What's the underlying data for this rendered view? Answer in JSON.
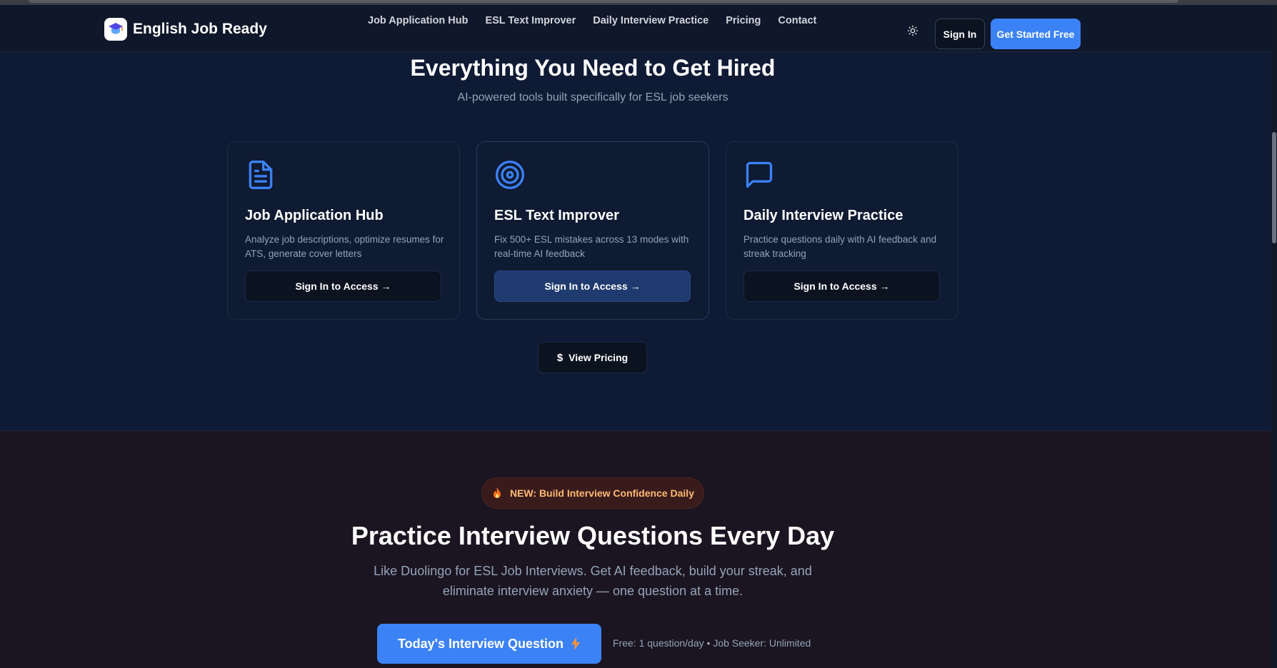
{
  "brand": {
    "name": "English Job Ready"
  },
  "nav": {
    "items": [
      {
        "label": "Job Application Hub"
      },
      {
        "label": "ESL Text Improver"
      },
      {
        "label": "Daily Interview Practice"
      },
      {
        "label": "Pricing"
      },
      {
        "label": "Contact"
      }
    ]
  },
  "header": {
    "theme_toggle_icon": "sun-icon",
    "sign_in_label": "Sign In",
    "get_started_label": "Get Started Free"
  },
  "features": {
    "title": "Everything You Need to Get Hired",
    "subtitle": "AI-powered tools built specifically for ESL job seekers",
    "cards": [
      {
        "icon": "document-icon",
        "title": "Job Application Hub",
        "description": "Analyze job descriptions, optimize resumes for ATS, generate cover letters",
        "button_label": "Sign In to Access →"
      },
      {
        "icon": "target-icon",
        "title": "ESL Text Improver",
        "description": "Fix 500+ ESL mistakes across 13 modes with real-time AI feedback",
        "button_label": "Sign In to Access →"
      },
      {
        "icon": "chat-bubble-icon",
        "title": "Daily Interview Practice",
        "description": "Practice questions daily with AI feedback and streak tracking",
        "button_label": "Sign In to Access →"
      }
    ],
    "view_pricing_label": "View Pricing"
  },
  "practice": {
    "badge_label": "NEW: Build Interview Confidence Daily",
    "title": "Practice Interview Questions Every Day",
    "description": "Like Duolingo for ESL Job Interviews. Get AI feedback, build your streak, and eliminate interview anxiety — one question at a time.",
    "cta_label": "Today's Interview Question",
    "free_note": "Free: 1 question/day • Job Seeker: Unlimited"
  },
  "colors": {
    "accent": "#3b82f6",
    "header_bg": "#0f172a",
    "features_bg": "#0f1a34",
    "practice_bg": "#1b1521",
    "badge_text": "#fdba74"
  }
}
